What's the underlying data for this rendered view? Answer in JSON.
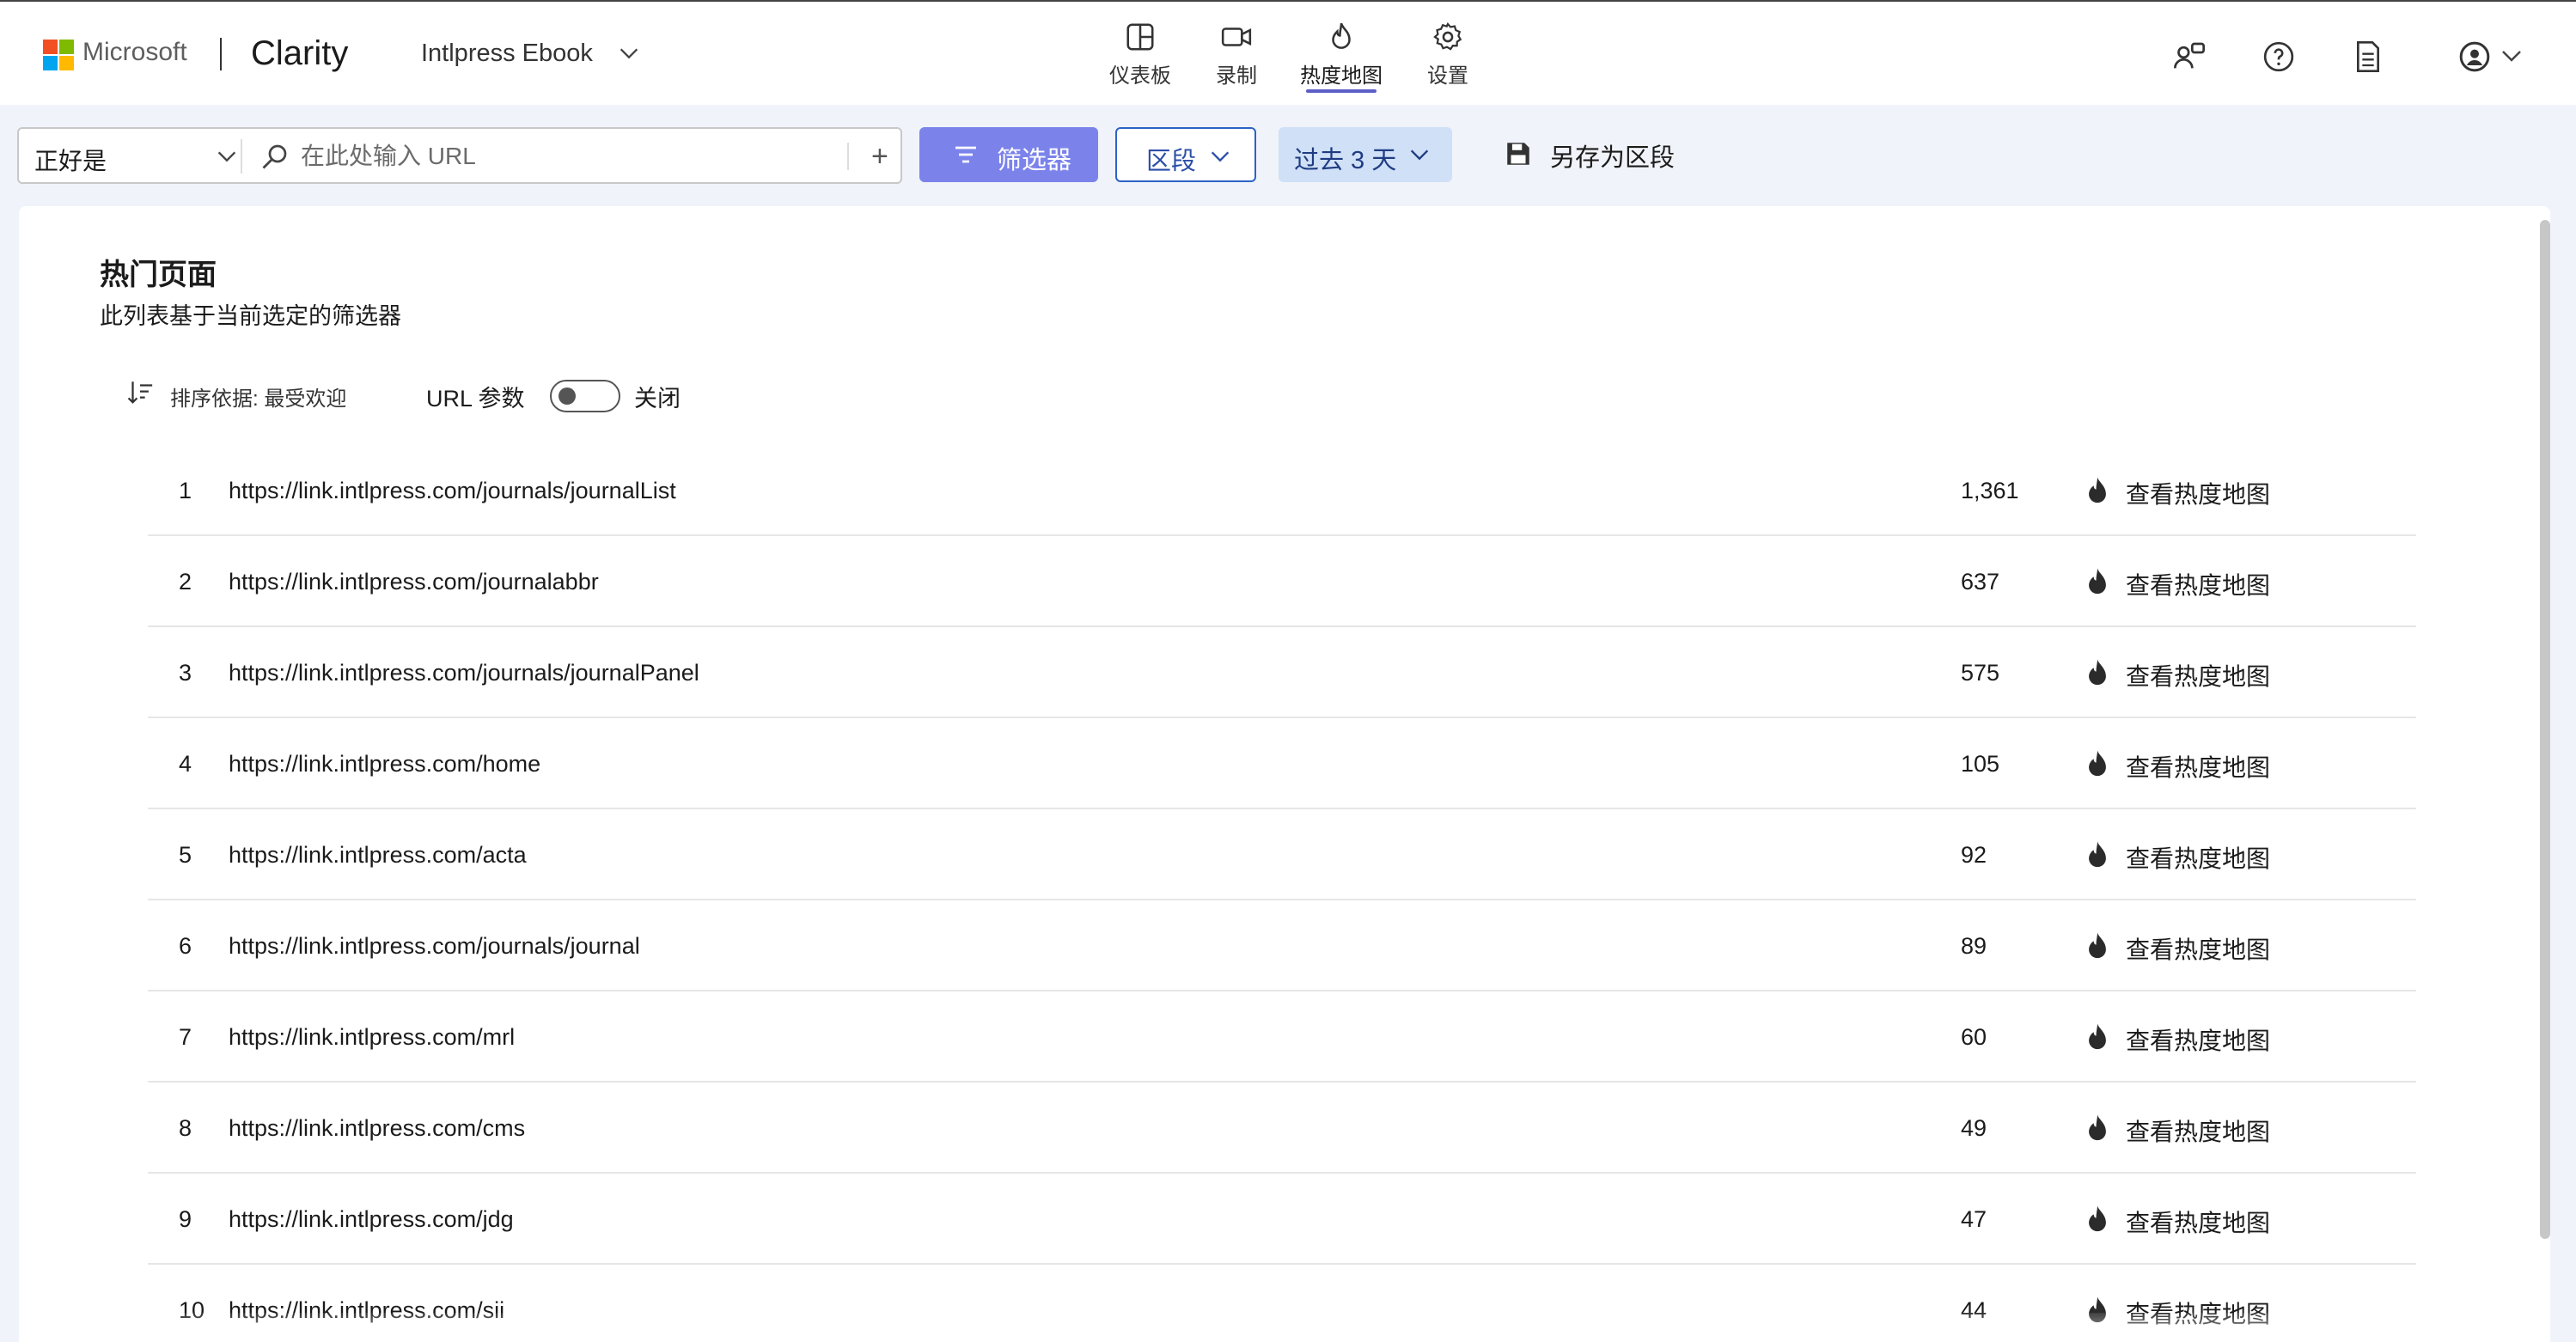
{
  "header": {
    "ms_logo_text": "Microsoft",
    "brand": "Clarity",
    "project": "Intlpress Ebook",
    "nav": [
      {
        "label": "仪表板",
        "icon": "dashboard-icon"
      },
      {
        "label": "录制",
        "icon": "recordings-icon"
      },
      {
        "label": "热度地图",
        "icon": "heatmap-icon",
        "active": true
      },
      {
        "label": "设置",
        "icon": "settings-icon"
      }
    ],
    "right_icons": [
      "share-people-icon",
      "help-icon",
      "document-icon",
      "account-icon"
    ]
  },
  "filterbar": {
    "match_mode": "正好是",
    "url_placeholder": "在此处输入 URL",
    "url_value": "",
    "add_label": "+",
    "filter_button": "筛选器",
    "segment_button": "区段",
    "date_button": "过去 3 天",
    "save_segment": "另存为区段"
  },
  "main": {
    "title": "热门页面",
    "subtitle": "此列表基于当前选定的筛选器",
    "sort_label": "排序依据: 最受欢迎",
    "url_param_label": "URL 参数",
    "url_param_state": "关闭",
    "url_param_on": false,
    "view_label": "查看热度地图",
    "rows": [
      {
        "rank": "1",
        "url": "https://link.intlpress.com/journals/journalList",
        "count": "1,361"
      },
      {
        "rank": "2",
        "url": "https://link.intlpress.com/journalabbr",
        "count": "637"
      },
      {
        "rank": "3",
        "url": "https://link.intlpress.com/journals/journalPanel",
        "count": "575"
      },
      {
        "rank": "4",
        "url": "https://link.intlpress.com/home",
        "count": "105"
      },
      {
        "rank": "5",
        "url": "https://link.intlpress.com/acta",
        "count": "92"
      },
      {
        "rank": "6",
        "url": "https://link.intlpress.com/journals/journal",
        "count": "89"
      },
      {
        "rank": "7",
        "url": "https://link.intlpress.com/mrl",
        "count": "60"
      },
      {
        "rank": "8",
        "url": "https://link.intlpress.com/cms",
        "count": "49"
      },
      {
        "rank": "9",
        "url": "https://link.intlpress.com/jdg",
        "count": "47"
      },
      {
        "rank": "10",
        "url": "https://link.intlpress.com/sii",
        "count": "44"
      }
    ]
  },
  "colors": {
    "accent": "#5b5fc7",
    "filter_button_bg": "#7b83eb",
    "segment_border": "#2b63c6",
    "date_bg": "#cfe0f7",
    "page_bg": "#f0f3f9"
  }
}
